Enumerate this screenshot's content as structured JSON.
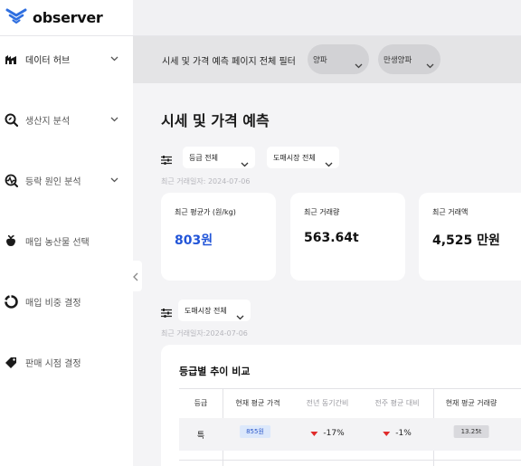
{
  "app": {
    "brand": "observer",
    "brand_color": "#2f6fe0"
  },
  "sidebar": {
    "items": [
      {
        "label": "데이터 허브",
        "icon": "building-icon",
        "has_chevron": true
      },
      {
        "label": "생산지 분석",
        "icon": "search-leaf-icon",
        "has_chevron": true
      },
      {
        "label": "등락 원인 분석",
        "icon": "pulse-search-icon",
        "has_chevron": true
      },
      {
        "label": "매입 농산물 선택",
        "icon": "produce-icon",
        "has_chevron": false
      },
      {
        "label": "매입 비중 결정",
        "icon": "ring-progress-icon",
        "has_chevron": false
      },
      {
        "label": "판매 시점 결정",
        "icon": "price-tag-icon",
        "has_chevron": false
      }
    ]
  },
  "filterbar": {
    "title": "시세 및 가격 예측 페이지 전체 필터",
    "item_select": "양파",
    "variety_select": "만생양파"
  },
  "main": {
    "page_title": "시세 및 가격 예측",
    "filters1": {
      "grade": "등급 전체",
      "market": "도매시장 전체"
    },
    "date_note_1": "최근 거래일자: 2024-07-06",
    "cards": [
      {
        "label": "최근 평균가 (원/kg)",
        "value": "803원"
      },
      {
        "label": "최근 거래량",
        "value": "563.64t"
      },
      {
        "label": "최근 거래액",
        "value": "4,525 만원"
      }
    ],
    "filters2": {
      "market": "도매시장 전체"
    },
    "date_note_2": "최근 거래일자:2024-07-06",
    "panel": {
      "title": "등급별 추이 비교",
      "headers": [
        "등급",
        "현재 평균 가격",
        "전년 동기간비",
        "전주 평균 대비",
        "현재 평균 거래량"
      ],
      "rows": [
        {
          "grade": "특",
          "price": "855원",
          "yoy": "-17%",
          "wow": "-1%",
          "volume": "13.25t"
        }
      ]
    }
  },
  "colors": {
    "accent_blue": "#2255d8",
    "down_red": "#e02a2a",
    "badge_blue_bg": "#dce8fb"
  }
}
